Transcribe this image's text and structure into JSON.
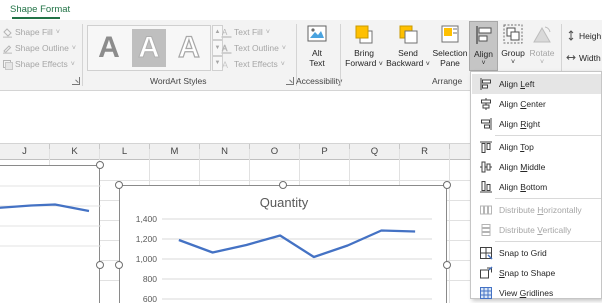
{
  "ribbon": {
    "active_tab": "Shape Format",
    "shape_styles": {
      "shape_fill": "Shape Fill",
      "shape_outline": "Shape Outline",
      "shape_effects": "Shape Effects"
    },
    "wordart": {
      "tile_letter": "A",
      "text_fill": "Text Fill",
      "text_outline": "Text Outline",
      "text_effects": "Text Effects",
      "group_label": "WordArt Styles"
    },
    "accessibility": {
      "alt_text_line1": "Alt",
      "alt_text_line2": "Text",
      "group_label": "Accessibility"
    },
    "arrange": {
      "bring_forward_line1": "Bring",
      "bring_forward_line2": "Forward",
      "send_backward_line1": "Send",
      "send_backward_line2": "Backward",
      "selection_pane_line1": "Selection",
      "selection_pane_line2": "Pane",
      "align": "Align",
      "group": "Group",
      "rotate": "Rotate",
      "group_label": "Arrange"
    },
    "size": {
      "height": "Heigh",
      "width": "Width"
    }
  },
  "sheet": {
    "columns": [
      "J",
      "K",
      "L",
      "M",
      "N",
      "O",
      "P",
      "Q",
      "R"
    ]
  },
  "chart": {
    "title": "Quantity"
  },
  "chart_data": {
    "type": "line",
    "title": "Quantity",
    "y_tick_labels": [
      "1,400",
      "1,200",
      "1,000",
      "800",
      "600"
    ],
    "ylim": [
      600,
      1400
    ],
    "gridlines": true,
    "series": [
      {
        "values": [
          1190,
          1065,
          1140,
          1235,
          1020,
          1135,
          1285,
          1275
        ]
      }
    ]
  },
  "left_chart_data": {
    "type": "line",
    "values": [
      1180,
      1205,
      1215,
      1150
    ]
  },
  "align_menu": {
    "items": [
      {
        "label": "Align Left",
        "accel": "L",
        "icon": "align-left-icon",
        "disabled": false,
        "hovered": true
      },
      {
        "label": "Align Center",
        "accel": "C",
        "icon": "align-center-icon",
        "disabled": false
      },
      {
        "label": "Align Right",
        "accel": "R",
        "icon": "align-right-icon",
        "disabled": false
      },
      {
        "sep": true
      },
      {
        "label": "Align Top",
        "accel": "T",
        "icon": "align-top-icon",
        "disabled": false
      },
      {
        "label": "Align Middle",
        "accel": "M",
        "icon": "align-middle-icon",
        "disabled": false
      },
      {
        "label": "Align Bottom",
        "accel": "B",
        "icon": "align-bottom-icon",
        "disabled": false
      },
      {
        "sep": true
      },
      {
        "label": "Distribute Horizontally",
        "accel": "H",
        "icon": "distribute-horizontally-icon",
        "disabled": true
      },
      {
        "label": "Distribute Vertically",
        "accel": "V",
        "icon": "distribute-vertically-icon",
        "disabled": true
      },
      {
        "sep": true
      },
      {
        "label": "Snap to Grid",
        "accel": "P",
        "icon": "snap-to-grid-icon",
        "disabled": false
      },
      {
        "label": "Snap to Shape",
        "accel": "S",
        "icon": "snap-to-shape-icon",
        "disabled": false
      },
      {
        "label": "View Gridlines",
        "accel": "G",
        "icon": "view-gridlines-icon",
        "disabled": false
      }
    ]
  }
}
